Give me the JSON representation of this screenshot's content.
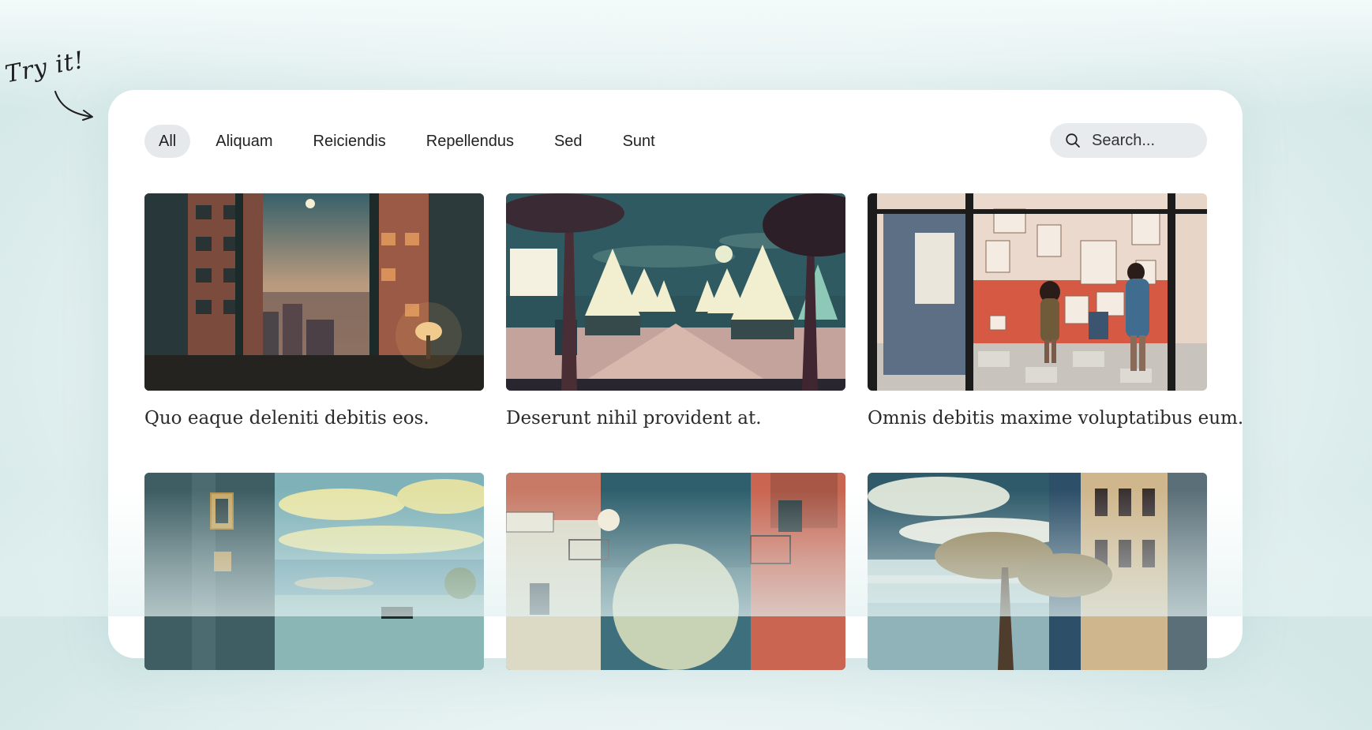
{
  "note": {
    "text": "Try it!"
  },
  "filters": [
    {
      "label": "All",
      "active": true
    },
    {
      "label": "Aliquam",
      "active": false
    },
    {
      "label": "Reiciendis",
      "active": false
    },
    {
      "label": "Repellendus",
      "active": false
    },
    {
      "label": "Sed",
      "active": false
    },
    {
      "label": "Sunt",
      "active": false
    }
  ],
  "search": {
    "placeholder": "Search..."
  },
  "items": [
    {
      "caption": "Quo eaque deleniti debitis eos.",
      "scene": "city-window-night"
    },
    {
      "caption": "Deserunt nihil provident at.",
      "scene": "tent-festival-moonlight"
    },
    {
      "caption": "Omnis debitis maxime voluptatibus eum.",
      "scene": "art-gallery-visitors"
    },
    {
      "caption": "",
      "scene": "bay-clouds-piano"
    },
    {
      "caption": "",
      "scene": "street-full-moon"
    },
    {
      "caption": "",
      "scene": "trees-building-coast"
    }
  ],
  "colors": {
    "accent_chip": "#e6e9ec",
    "card": "#ffffff",
    "background": "#dcecec"
  }
}
